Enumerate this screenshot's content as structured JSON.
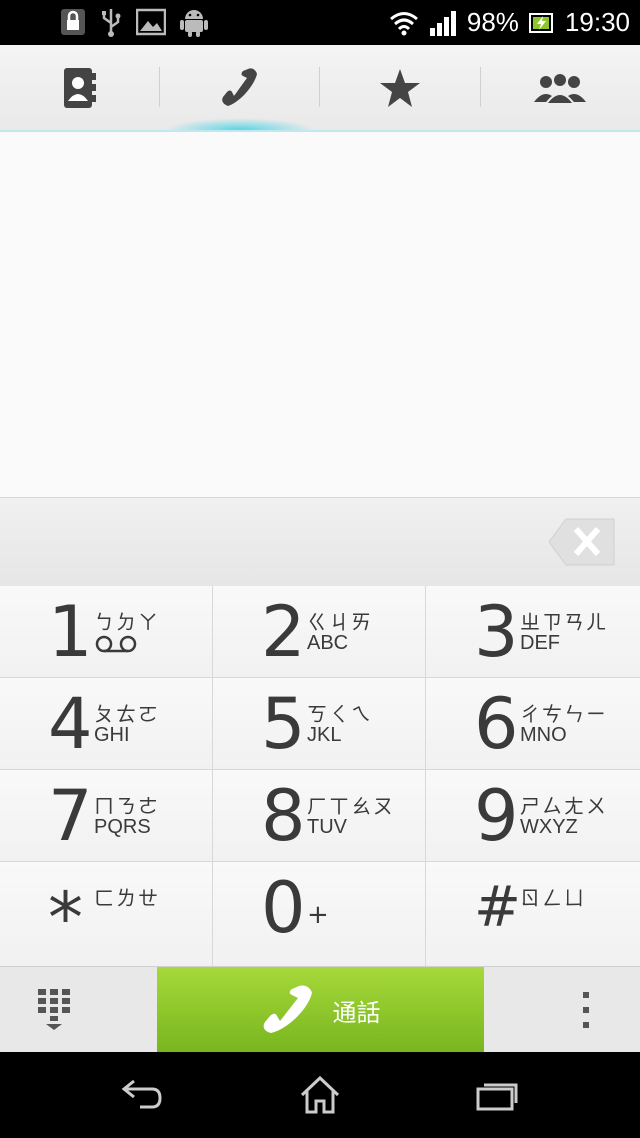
{
  "status_bar": {
    "battery_percent": "98%",
    "time": "19:30",
    "left_icons": [
      "lock-icon",
      "usb-icon",
      "image-icon",
      "android-icon"
    ],
    "right_icons": [
      "wifi-icon",
      "signal-icon",
      "battery-icon"
    ]
  },
  "tabs": [
    {
      "name": "contacts",
      "icon": "contacts-icon"
    },
    {
      "name": "phone",
      "icon": "phone-icon",
      "selected": true
    },
    {
      "name": "favorites",
      "icon": "star-icon"
    },
    {
      "name": "groups",
      "icon": "groups-icon"
    }
  ],
  "dial_input": {
    "value": ""
  },
  "keys": [
    {
      "digit": "1",
      "sub1": "ㄅㄉㄚ",
      "sub2": ""
    },
    {
      "digit": "2",
      "sub1": "ㄍㄐㄞ",
      "sub2": "ABC"
    },
    {
      "digit": "3",
      "sub1": "ㄓㄗㄢㄦ",
      "sub2": "DEF"
    },
    {
      "digit": "4",
      "sub1": "ㄆㄊㄛ",
      "sub2": "GHI"
    },
    {
      "digit": "5",
      "sub1": "ㄎㄑㄟ",
      "sub2": "JKL"
    },
    {
      "digit": "6",
      "sub1": "ㄔㄘㄣㄧ",
      "sub2": "MNO"
    },
    {
      "digit": "7",
      "sub1": "ㄇㄋㄜ",
      "sub2": "PQRS"
    },
    {
      "digit": "8",
      "sub1": "ㄏㄒㄠㄡ",
      "sub2": "TUV"
    },
    {
      "digit": "9",
      "sub1": "ㄕㄙㄤㄨ",
      "sub2": "WXYZ"
    },
    {
      "digit": "*",
      "sub1": "ㄈㄌㄝ",
      "sub2": ""
    },
    {
      "digit": "0",
      "sub1": "+",
      "sub2": ""
    },
    {
      "digit": "#",
      "sub1": "ㄖㄥㄩ",
      "sub2": ""
    }
  ],
  "bottom": {
    "call_label": "通話"
  },
  "colors": {
    "call_green": "#8cc62a",
    "accent_cyan": "#57d5e4"
  }
}
